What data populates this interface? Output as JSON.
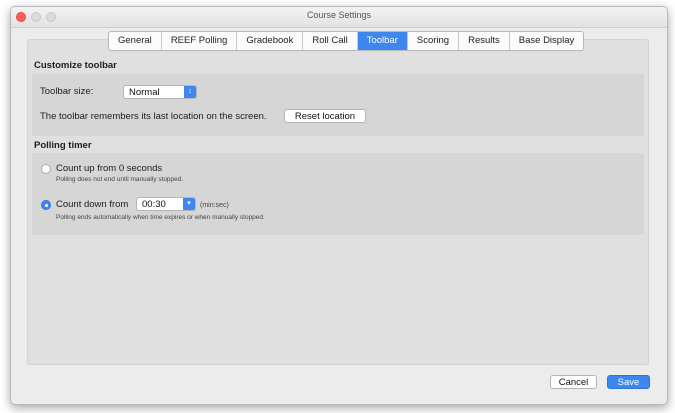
{
  "window": {
    "title": "Course Settings"
  },
  "tabs": [
    {
      "label": "General"
    },
    {
      "label": "REEF Polling"
    },
    {
      "label": "Gradebook"
    },
    {
      "label": "Roll Call"
    },
    {
      "label": "Toolbar",
      "active": true
    },
    {
      "label": "Scoring"
    },
    {
      "label": "Results"
    },
    {
      "label": "Base Display"
    }
  ],
  "toolbar_section": {
    "title": "Customize toolbar",
    "size_label": "Toolbar size:",
    "size_value": "Normal",
    "location_text": "The toolbar remembers its last location on the screen.",
    "reset_button": "Reset location"
  },
  "polling_section": {
    "title": "Polling timer",
    "count_up_label": "Count up from 0 seconds",
    "count_up_hint": "Polling does not end until manually stopped.",
    "count_down_label": "Count down from",
    "count_down_value": "00:30",
    "count_down_unit": "(min:sec)",
    "count_down_hint": "Polling ends automatically when time expires or when manually stopped.",
    "selected": "count_down"
  },
  "footer": {
    "cancel_label": "Cancel",
    "save_label": "Save"
  },
  "colors": {
    "accent": "#3d87ef",
    "close": "#fc605c"
  }
}
